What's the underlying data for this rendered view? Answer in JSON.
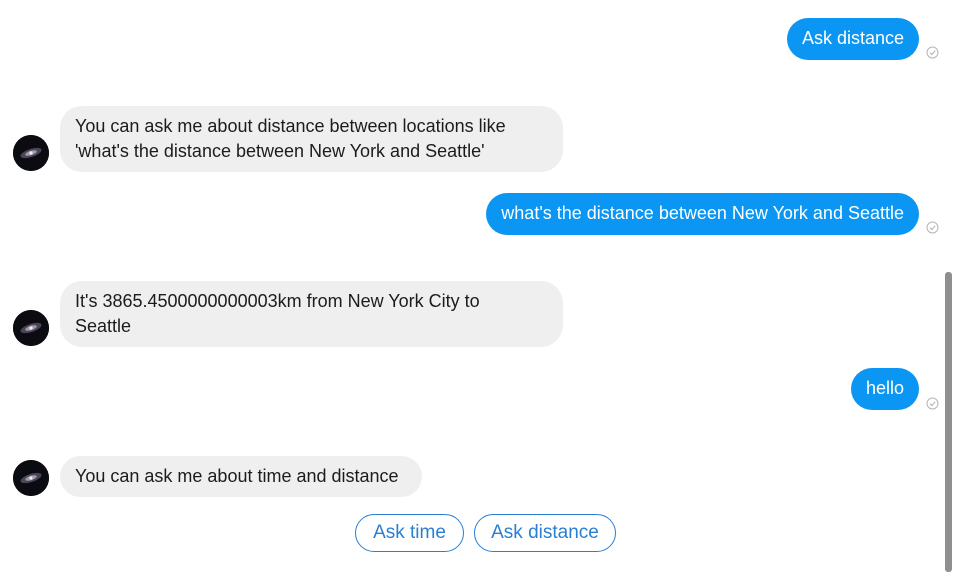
{
  "messages": [
    {
      "sender": "user",
      "text": "Ask distance",
      "status": "sent"
    },
    {
      "sender": "bot",
      "lines": [
        "You can ask me about distance between locations like",
        "'what's the distance between New York and Seattle'"
      ]
    },
    {
      "sender": "user",
      "text": "what's the distance between New York and Seattle",
      "status": "sent"
    },
    {
      "sender": "bot",
      "lines": [
        "It's 3865.4500000000003km from New York City to",
        "Seattle"
      ]
    },
    {
      "sender": "user",
      "text": "hello",
      "status": "sent"
    },
    {
      "sender": "bot",
      "lines": [
        "You can ask me about time and distance"
      ]
    }
  ],
  "quick_replies": [
    "Ask time",
    "Ask distance"
  ],
  "colors": {
    "user_bubble": "#0a96f2",
    "bot_bubble": "#f0eff0",
    "quick_reply_border": "#2a7fd0",
    "scrollbar_thumb": "#8f8f8f"
  },
  "icons": {
    "sent_status": "check-circle-icon",
    "bot_avatar": "galaxy-avatar"
  }
}
